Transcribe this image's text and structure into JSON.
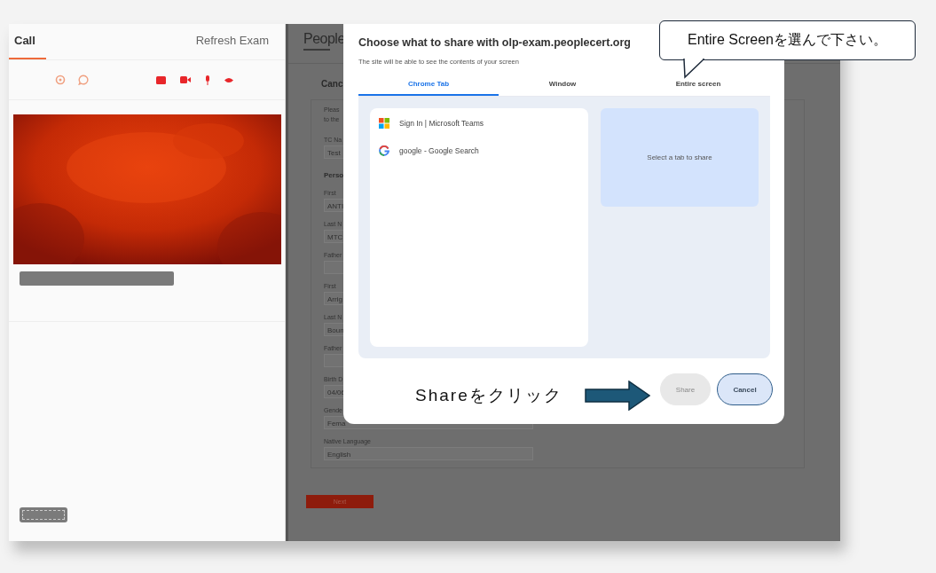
{
  "sidebar": {
    "tabs": [
      {
        "label": "Call",
        "selected": true
      },
      {
        "label": "Refresh Exam",
        "selected": false
      }
    ]
  },
  "exam_page": {
    "logo": "People",
    "heading": "Canc",
    "notes": [
      "Pleas",
      "to the"
    ],
    "sections": [
      {
        "kind": "field",
        "label": "TC Na",
        "value": "Test"
      },
      {
        "kind": "heading",
        "label": "Perso"
      },
      {
        "kind": "field",
        "label": "First",
        "value": "ANTI"
      },
      {
        "kind": "field",
        "label": "Last N",
        "value": "MTC"
      },
      {
        "kind": "field",
        "label": "Father"
      },
      {
        "kind": "field",
        "label": "First",
        "value": "Arrig"
      },
      {
        "kind": "field",
        "label": "Last N",
        "value": "Boun"
      },
      {
        "kind": "field",
        "label": "Father"
      },
      {
        "kind": "field",
        "label": "Birth D",
        "value": "04/06"
      },
      {
        "kind": "field",
        "label": "Gende",
        "value": "Fema"
      },
      {
        "kind": "field",
        "label": "Native Language",
        "value": "English"
      }
    ],
    "next_button": "Next"
  },
  "dialog": {
    "title": "Choose what to share with olp-exam.peoplecert.org",
    "subtitle": "The site will be able to see the contents of your screen",
    "tabs": [
      {
        "label": "Chrome Tab",
        "selected": true
      },
      {
        "label": "Window",
        "selected": false
      },
      {
        "label": "Entire screen",
        "selected": false
      }
    ],
    "items": [
      {
        "label": "Sign In | Microsoft Teams",
        "kind": "teams"
      },
      {
        "label": "google - Google Search",
        "kind": "google"
      }
    ],
    "preview": "Select a tab to share",
    "buttons": [
      {
        "label": "Share",
        "disabled": true
      },
      {
        "label": "Cancel",
        "disabled": false
      }
    ]
  },
  "annotations": [
    {
      "kind": "callout",
      "text": "Entire Screenを選んで下さい。"
    },
    {
      "kind": "arrow",
      "text": "Shareをクリック"
    }
  ]
}
